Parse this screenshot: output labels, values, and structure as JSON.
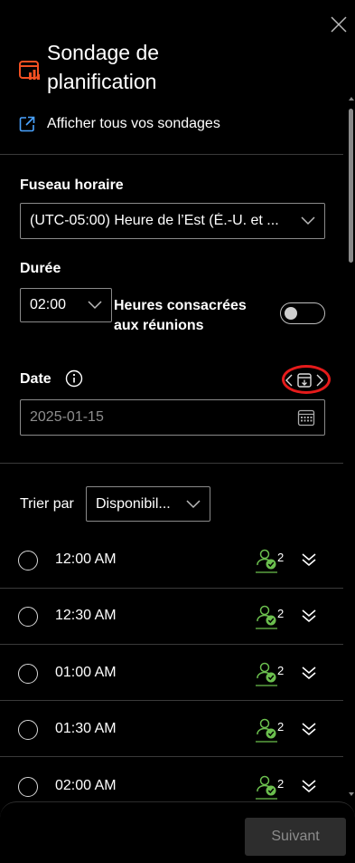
{
  "header": {
    "title_line1": "Sondage de",
    "title_line2": "planification",
    "link_text": "Afficher tous vos sondages"
  },
  "timezone": {
    "label": "Fuseau horaire",
    "value": "(UTC-05:00) Heure de l’Est (É.-U. et ..."
  },
  "duration": {
    "label": "Durée",
    "value": "02:00",
    "toggle_label_line1": "Heures consacrées",
    "toggle_label_line2": "aux réunions",
    "toggle_on": false
  },
  "date": {
    "label": "Date",
    "placeholder": "2025-01-15"
  },
  "sort": {
    "label": "Trier par",
    "value": "Disponibil..."
  },
  "slots": [
    {
      "time": "12:00 AM",
      "count": "2"
    },
    {
      "time": "12:30 AM",
      "count": "2"
    },
    {
      "time": "01:00 AM",
      "count": "2"
    },
    {
      "time": "01:30 AM",
      "count": "2"
    },
    {
      "time": "02:00 AM",
      "count": "2"
    }
  ],
  "footer": {
    "next_label": "Suivant"
  },
  "colors": {
    "accent_orange": "#f25022",
    "link_blue": "#4aa3ff",
    "available_green": "#6bbf4e",
    "highlight_red": "#e51b1b"
  },
  "icons": [
    "close-icon",
    "scheduling-poll-icon",
    "open-external-icon",
    "chevron-down-icon",
    "info-icon",
    "prev-icon",
    "calendar-add-icon",
    "next-icon",
    "calendar-icon",
    "attendees-available-icon",
    "expand-icon"
  ]
}
